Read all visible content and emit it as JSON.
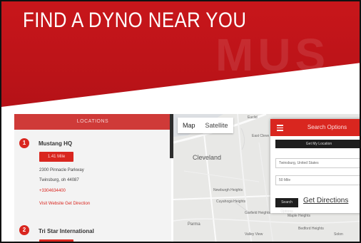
{
  "hero": {
    "title": "FIND A DYNO NEAR YOU",
    "watermark": "MUS"
  },
  "list": {
    "header": "LOCATIONS",
    "dealers": [
      {
        "number": "1",
        "name": "Mustang HQ",
        "miles": "1.41 Mile",
        "address1": "2300 Pinnacle Parkway",
        "address2": "Twinsburg, oh 44087",
        "phone": "+3304634400",
        "links": "Visit Website Get Direction"
      },
      {
        "number": "2",
        "name": "Tri Star International",
        "miles": ""
      }
    ]
  },
  "map": {
    "type_options": [
      "Map",
      "Satellite"
    ],
    "city": "Cleveland",
    "labels": [
      "East Cleve",
      "Euclid",
      "Newburgh Heights",
      "Cuyahoga Heights",
      "Garfield Heights",
      "Parma",
      "Maple Heights",
      "Valley View",
      "Bedford Heights",
      "Solon"
    ]
  },
  "search": {
    "title": "Search Options",
    "get_location": "Get My Location",
    "location_value": "Twinsburg, United States",
    "radius_value": "50 Mile",
    "search_button": "Search Options",
    "get_directions": "Get Directions"
  },
  "colors": {
    "brand_red": "#d9261f",
    "hero_red": "#c8161b",
    "dark_button": "#1e1e1e"
  },
  "icons": [
    "hamburger-menu-icon",
    "map-pin-icon"
  ]
}
